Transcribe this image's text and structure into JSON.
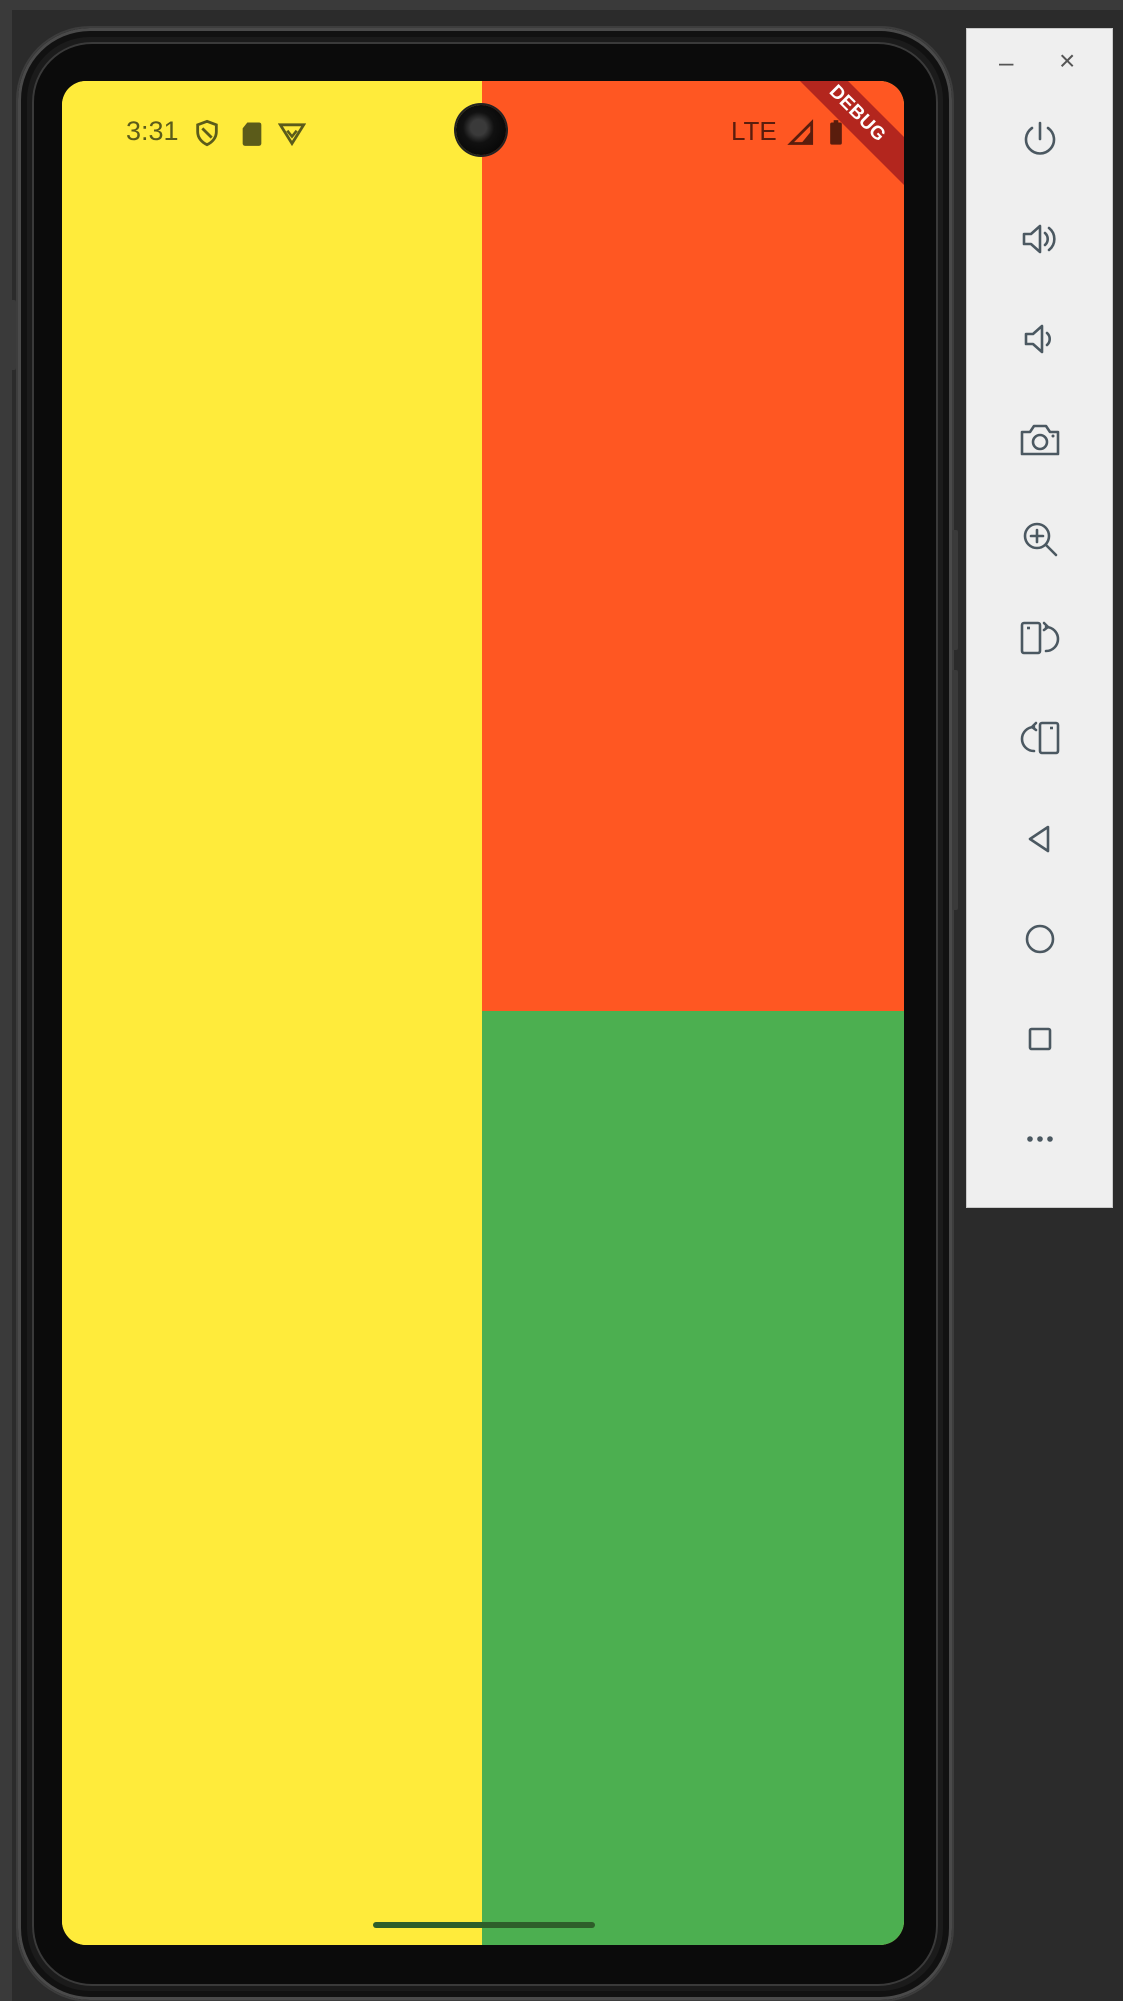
{
  "status_bar": {
    "time": "3:31",
    "network": "LTE",
    "debug_banner": "DEBUG"
  },
  "colors": {
    "left_panel": "#FFEB3B",
    "top_right_panel": "#FF5722",
    "bottom_right_panel": "#4CAF50"
  },
  "emulator_toolbar": {
    "window_controls": {
      "minimize": "–",
      "close": "×"
    },
    "buttons": [
      "power-icon",
      "volume-up-icon",
      "volume-down-icon",
      "camera-icon",
      "zoom-in-icon",
      "rotate-right-icon",
      "rotate-left-icon",
      "back-icon",
      "home-icon",
      "overview-icon",
      "more-icon"
    ]
  }
}
